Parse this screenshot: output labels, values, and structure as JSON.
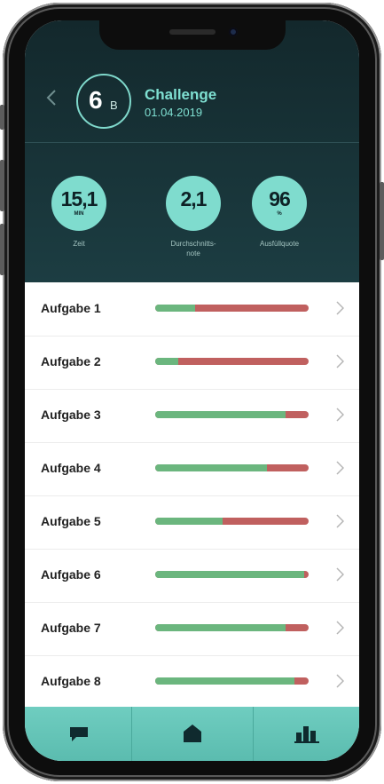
{
  "header": {
    "grade_number": "6",
    "grade_letter": "B",
    "title": "Challenge",
    "date": "01.04.2019"
  },
  "stats": [
    {
      "value": "15,1",
      "unit": "MIN",
      "label": "Zeit"
    },
    {
      "value": "2,1",
      "unit": "",
      "label": "Durchschnitts-\nnote"
    },
    {
      "value": "96",
      "unit": "%",
      "label": "Ausfüllquote"
    }
  ],
  "tasks": [
    {
      "label": "Aufgabe 1",
      "correct_fraction": 0.26
    },
    {
      "label": "Aufgabe 2",
      "correct_fraction": 0.15
    },
    {
      "label": "Aufgabe 3",
      "correct_fraction": 0.85
    },
    {
      "label": "Aufgabe 4",
      "correct_fraction": 0.73
    },
    {
      "label": "Aufgabe 5",
      "correct_fraction": 0.44
    },
    {
      "label": "Aufgabe 6",
      "correct_fraction": 0.97
    },
    {
      "label": "Aufgabe 7",
      "correct_fraction": 0.85
    },
    {
      "label": "Aufgabe 8",
      "correct_fraction": 0.91
    }
  ],
  "colors": {
    "correct": "#6bb67e",
    "wrong": "#c0605f",
    "accent": "#7fdcce",
    "header_bg": "#1c3d42"
  },
  "tabbar": {
    "items": [
      {
        "icon": "chat-bubble-icon"
      },
      {
        "icon": "home-icon"
      },
      {
        "icon": "bar-chart-icon"
      }
    ]
  }
}
